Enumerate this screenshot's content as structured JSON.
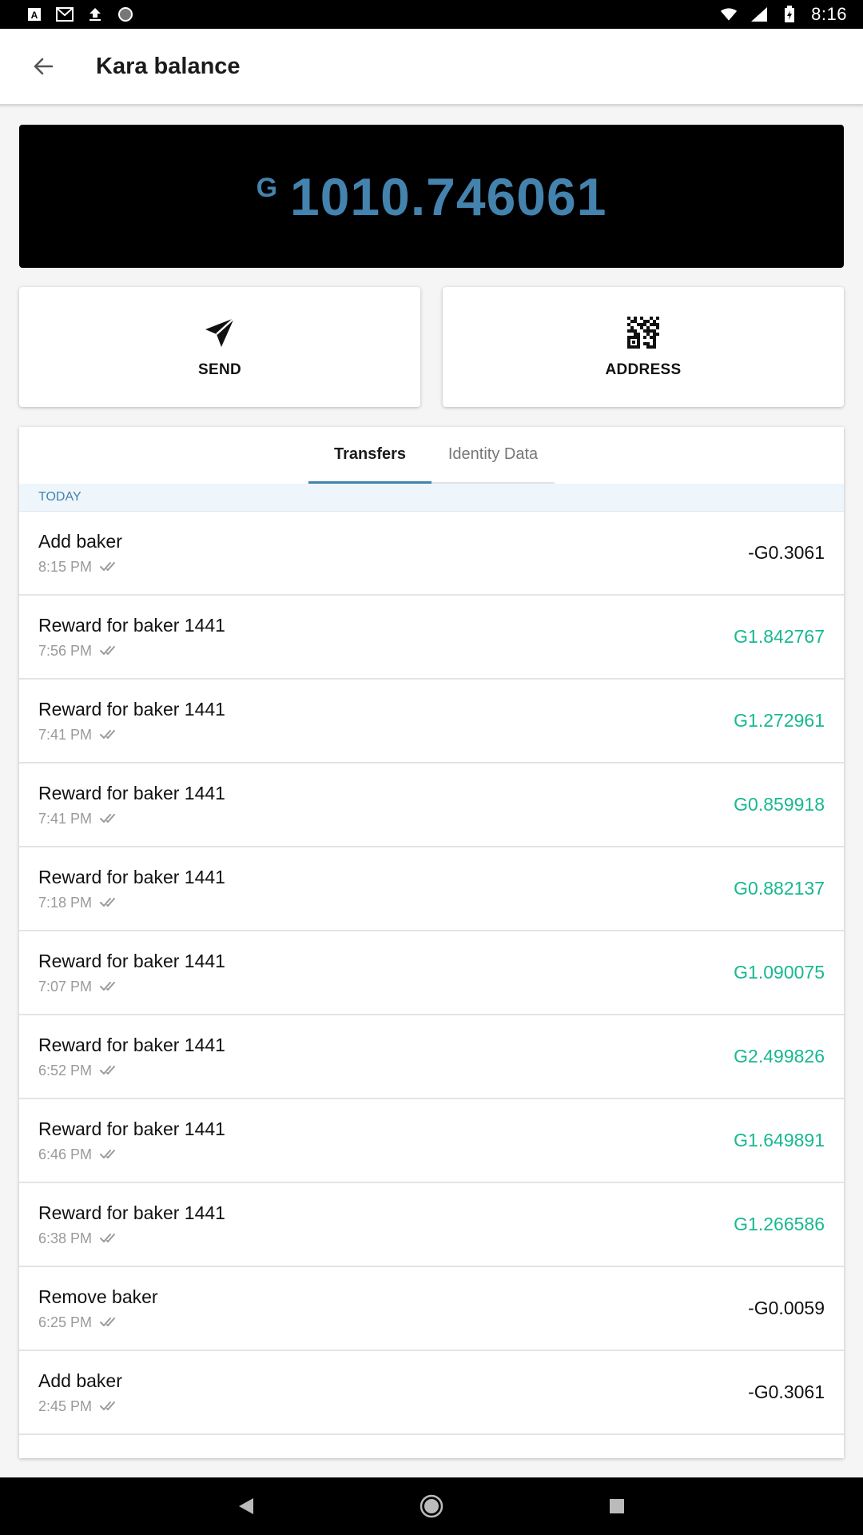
{
  "status_bar": {
    "time": "8:16",
    "left_icons": [
      "a-box-icon",
      "gmail-icon",
      "upload-icon",
      "circle-icon"
    ],
    "right_icons": [
      "wifi-icon",
      "signal-icon",
      "battery-icon"
    ]
  },
  "app_bar": {
    "title": "Kara balance",
    "back_icon": "arrow-back-icon"
  },
  "balance": {
    "symbol": "G",
    "amount": "1010.746061",
    "color": "#4383ae"
  },
  "actions": {
    "send_label": "SEND",
    "send_icon": "paper-plane-icon",
    "address_label": "ADDRESS",
    "address_icon": "qr-code-icon"
  },
  "tabs": [
    {
      "label": "Transfers",
      "active": true
    },
    {
      "label": "Identity Data",
      "active": false
    }
  ],
  "section": {
    "label": "TODAY"
  },
  "transactions": [
    {
      "title": "Add baker",
      "time": "8:15 PM",
      "amount": "-G0.3061",
      "positive": false
    },
    {
      "title": "Reward for baker 1441",
      "time": "7:56 PM",
      "amount": "G1.842767",
      "positive": true
    },
    {
      "title": "Reward for baker 1441",
      "time": "7:41 PM",
      "amount": "G1.272961",
      "positive": true
    },
    {
      "title": "Reward for baker 1441",
      "time": "7:41 PM",
      "amount": "G0.859918",
      "positive": true
    },
    {
      "title": "Reward for baker 1441",
      "time": "7:18 PM",
      "amount": "G0.882137",
      "positive": true
    },
    {
      "title": "Reward for baker 1441",
      "time": "7:07 PM",
      "amount": "G1.090075",
      "positive": true
    },
    {
      "title": "Reward for baker 1441",
      "time": "6:52 PM",
      "amount": "G2.499826",
      "positive": true
    },
    {
      "title": "Reward for baker 1441",
      "time": "6:46 PM",
      "amount": "G1.649891",
      "positive": true
    },
    {
      "title": "Reward for baker 1441",
      "time": "6:38 PM",
      "amount": "G1.266586",
      "positive": true
    },
    {
      "title": "Remove baker",
      "time": "6:25 PM",
      "amount": "-G0.0059",
      "positive": false
    },
    {
      "title": "Add baker",
      "time": "2:45 PM",
      "amount": "-G0.3061",
      "positive": false
    }
  ],
  "colors": {
    "positive": "#18b890",
    "accent": "#4383ae"
  },
  "nav_bar": {
    "icons": [
      "back-triangle-icon",
      "home-circle-icon",
      "recents-square-icon"
    ]
  }
}
